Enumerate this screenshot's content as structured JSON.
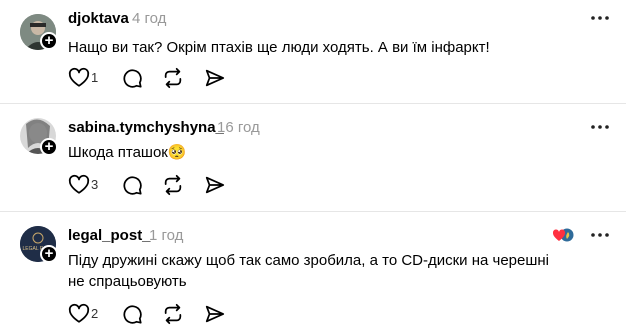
{
  "posts": [
    {
      "username": "djoktava",
      "time": "4 год",
      "text": "Нащо ви так? Окрім птахів ще люди ходять. А ви їм інфаркт!",
      "like_count": "1"
    },
    {
      "username": "sabina.tymchyshyna_",
      "time": "16 год",
      "text": "Шкода пташок🥺",
      "like_count": "3"
    },
    {
      "username": "legal_post_",
      "time": "1 год",
      "text_line1": "Піду дружині скажу щоб так само зробила, а то CD-диски на черешні",
      "text_line2": "не спрацьовують",
      "like_count": "2",
      "avatar_text": "LEGAL POST"
    }
  ],
  "icons": {
    "like": "heart-icon",
    "reply": "comment-icon",
    "repost": "repost-icon",
    "share": "send-icon",
    "more": "more-icon",
    "follow": "plus-icon"
  }
}
